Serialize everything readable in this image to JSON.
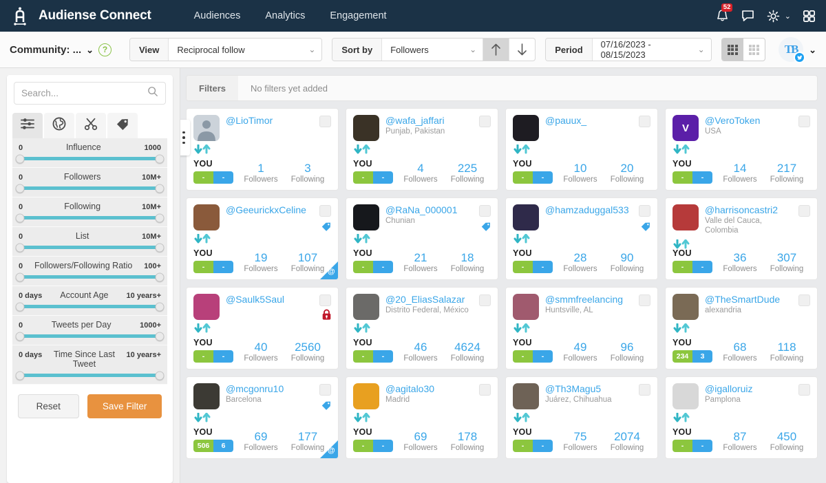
{
  "header": {
    "brand": "Audiense Connect",
    "logo_icon": "audiense-a-logo",
    "nav": [
      {
        "label": "Audiences",
        "name": "nav-audiences"
      },
      {
        "label": "Analytics",
        "name": "nav-analytics"
      },
      {
        "label": "Engagement",
        "name": "nav-engagement"
      }
    ],
    "notifications_badge": "52",
    "icons": {
      "bell": "bell-icon",
      "chat": "chat-icon",
      "gear": "gear-icon",
      "apps": "apps-grid-icon"
    }
  },
  "toolbar": {
    "community_label": "Community: ...",
    "help_label": "?",
    "view_label": "View",
    "view_value": "Reciprocal follow",
    "sort_label": "Sort by",
    "sort_value": "Followers",
    "sort_asc_icon": "arrow-up-icon",
    "sort_desc_icon": "arrow-down-icon",
    "period_label": "Period",
    "period_value": "07/16/2023 - 08/15/2023",
    "account_initials": "TB"
  },
  "sidebar": {
    "search_placeholder": "Search...",
    "search_value": "",
    "tabs": [
      {
        "name": "tab-filters",
        "icon": "sliders-icon",
        "active": true
      },
      {
        "name": "tab-geography",
        "icon": "globe-icon",
        "active": false
      },
      {
        "name": "tab-segments",
        "icon": "scissors-icon",
        "active": false
      },
      {
        "name": "tab-tags",
        "icon": "tag-icon",
        "active": false
      }
    ],
    "sliders": [
      {
        "label": "Influence",
        "min": "0",
        "max": "1000"
      },
      {
        "label": "Followers",
        "min": "0",
        "max": "10M+"
      },
      {
        "label": "Following",
        "min": "0",
        "max": "10M+"
      },
      {
        "label": "List",
        "min": "0",
        "max": "10M+"
      },
      {
        "label": "Followers/Following Ratio",
        "min": "0",
        "max": "100+"
      },
      {
        "label": "Account Age",
        "min": "0 days",
        "max": "10 years+"
      },
      {
        "label": "Tweets per Day",
        "min": "0",
        "max": "1000+"
      },
      {
        "label": "Time Since Last Tweet",
        "min": "0 days",
        "max": "10 years+"
      }
    ],
    "reset_label": "Reset",
    "save_label": "Save Filter",
    "save_color": "#e8923f",
    "slider_color": "#5bc0cf"
  },
  "filters_bar": {
    "tab_label": "Filters",
    "empty_text": "No filters yet added"
  },
  "cards_labels": {
    "you": "YOU",
    "followers": "Followers",
    "following": "Following",
    "pill_empty": "-"
  },
  "cards": [
    {
      "handle": "@LioTimor",
      "location": "",
      "followers": "1",
      "following": "3",
      "pill_green": "-",
      "pill_blue": "-",
      "tag": false,
      "lock": false,
      "at_corner": false,
      "avatar_color": "#c5ccd3",
      "avatar_text": ""
    },
    {
      "handle": "@wafa_jaffari",
      "location": "Punjab, Pakistan",
      "followers": "4",
      "following": "225",
      "pill_green": "-",
      "pill_blue": "-",
      "tag": false,
      "lock": false,
      "at_corner": false,
      "avatar_color": "#3a3226",
      "avatar_text": ""
    },
    {
      "handle": "@pauux_",
      "location": "",
      "followers": "10",
      "following": "20",
      "pill_green": "-",
      "pill_blue": "-",
      "tag": false,
      "lock": false,
      "at_corner": false,
      "avatar_color": "#1e1c22",
      "avatar_text": ""
    },
    {
      "handle": "@VeroToken",
      "location": "USA",
      "followers": "14",
      "following": "217",
      "pill_green": "-",
      "pill_blue": "-",
      "tag": false,
      "lock": false,
      "at_corner": false,
      "avatar_color": "#5b1fa8",
      "avatar_text": "V"
    },
    {
      "handle": "@GeeurickxCeline",
      "location": "",
      "followers": "19",
      "following": "107",
      "pill_green": "-",
      "pill_blue": "-",
      "tag": true,
      "lock": false,
      "at_corner": true,
      "avatar_color": "#8a5a3b",
      "avatar_text": ""
    },
    {
      "handle": "@RaNa_000001",
      "location": "Chunian",
      "followers": "21",
      "following": "18",
      "pill_green": "-",
      "pill_blue": "-",
      "tag": true,
      "lock": false,
      "at_corner": false,
      "avatar_color": "#16181c",
      "avatar_text": ""
    },
    {
      "handle": "@hamzaduggal533",
      "location": "",
      "followers": "28",
      "following": "90",
      "pill_green": "-",
      "pill_blue": "-",
      "tag": true,
      "lock": false,
      "at_corner": false,
      "avatar_color": "#2f2a4a",
      "avatar_text": ""
    },
    {
      "handle": "@harrisoncastri2",
      "location": "Valle del Cauca, Colombia",
      "followers": "36",
      "following": "307",
      "pill_green": "-",
      "pill_blue": "-",
      "tag": false,
      "lock": false,
      "at_corner": false,
      "avatar_color": "#b63a3a",
      "avatar_text": ""
    },
    {
      "handle": "@Saulk5Saul",
      "location": "",
      "followers": "40",
      "following": "2560",
      "pill_green": "-",
      "pill_blue": "-",
      "tag": false,
      "lock": true,
      "at_corner": false,
      "avatar_color": "#b8407a",
      "avatar_text": ""
    },
    {
      "handle": "@20_EliasSalazar",
      "location": "Distrito Federal, México",
      "followers": "46",
      "following": "4624",
      "pill_green": "-",
      "pill_blue": "-",
      "tag": false,
      "lock": false,
      "at_corner": false,
      "avatar_color": "#6b6a68",
      "avatar_text": ""
    },
    {
      "handle": "@smmfreelancing",
      "location": "Huntsville, AL",
      "followers": "49",
      "following": "96",
      "pill_green": "-",
      "pill_blue": "-",
      "tag": false,
      "lock": false,
      "at_corner": false,
      "avatar_color": "#a05a6e",
      "avatar_text": ""
    },
    {
      "handle": "@TheSmartDude",
      "location": "alexandria",
      "followers": "68",
      "following": "118",
      "pill_green": "234",
      "pill_blue": "3",
      "tag": false,
      "lock": false,
      "at_corner": false,
      "avatar_color": "#7a6a55",
      "avatar_text": ""
    },
    {
      "handle": "@mcgonru10",
      "location": "Barcelona",
      "followers": "69",
      "following": "177",
      "pill_green": "506",
      "pill_blue": "6",
      "tag": true,
      "lock": false,
      "at_corner": true,
      "avatar_color": "#3c3a34",
      "avatar_text": ""
    },
    {
      "handle": "@agitalo30",
      "location": "Madrid",
      "followers": "69",
      "following": "178",
      "pill_green": "-",
      "pill_blue": "-",
      "tag": false,
      "lock": false,
      "at_corner": false,
      "avatar_color": "#e8a020",
      "avatar_text": ""
    },
    {
      "handle": "@Th3Magu5",
      "location": "Juárez, Chihuahua",
      "followers": "75",
      "following": "2074",
      "pill_green": "-",
      "pill_blue": "-",
      "tag": false,
      "lock": false,
      "at_corner": false,
      "avatar_color": "#6e6256",
      "avatar_text": ""
    },
    {
      "handle": "@igalloruiz",
      "location": "Pamplona",
      "followers": "87",
      "following": "450",
      "pill_green": "-",
      "pill_blue": "-",
      "tag": false,
      "lock": false,
      "at_corner": false,
      "avatar_color": "#d8d8d8",
      "avatar_text": ""
    }
  ]
}
